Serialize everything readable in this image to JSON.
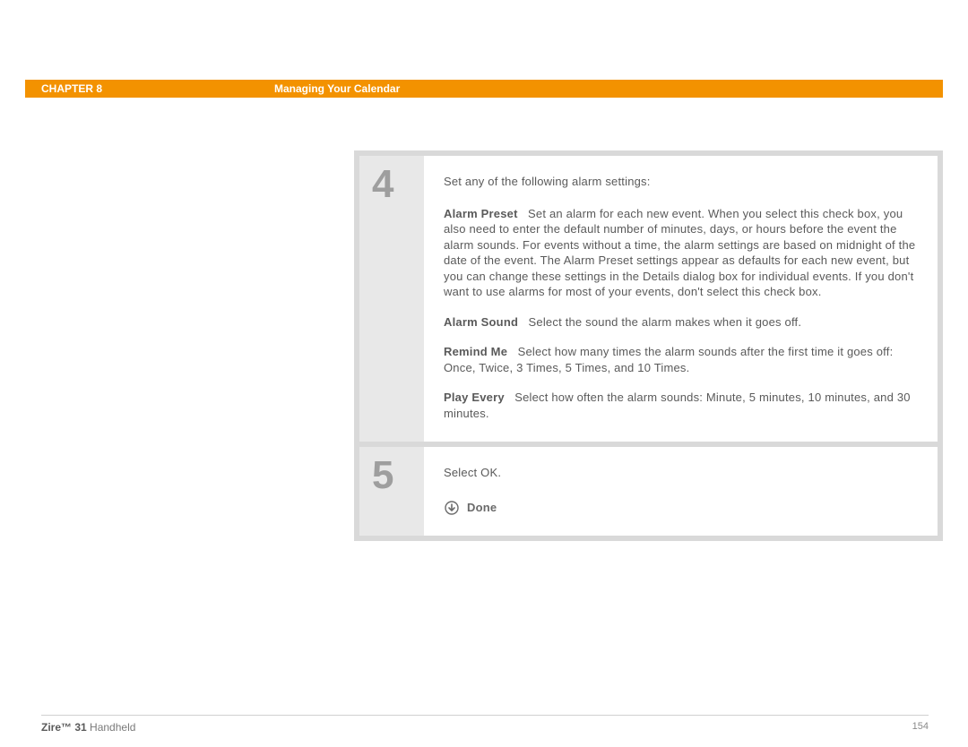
{
  "header": {
    "chapter": "CHAPTER 8",
    "title": "Managing Your Calendar"
  },
  "steps": [
    {
      "num": "4",
      "intro": "Set any of the following alarm settings:",
      "items": [
        {
          "label": "Alarm Preset",
          "text": "Set an alarm for each new event. When you select this check box, you also need to enter the default number of minutes, days, or hours before the event the alarm sounds. For events without a time, the alarm settings are based on midnight of the date of the event. The Alarm Preset settings appear as defaults for each new event, but you can change these settings in the Details dialog box for individual events. If you don't want to use alarms for most of your events, don't select this check box."
        },
        {
          "label": "Alarm Sound",
          "text": "Select the sound the alarm makes when it goes off."
        },
        {
          "label": "Remind Me",
          "text": "Select how many times the alarm sounds after the first time it goes off: Once, Twice, 3 Times, 5 Times, and 10 Times."
        },
        {
          "label": "Play Every",
          "text": "Select how often the alarm sounds: Minute, 5 minutes, 10 minutes, and 30 minutes."
        }
      ]
    },
    {
      "num": "5",
      "intro": "Select OK.",
      "done": "Done"
    }
  ],
  "footer": {
    "product_bold": "Zire™ 31",
    "product_rest": " Handheld",
    "page": "154"
  }
}
